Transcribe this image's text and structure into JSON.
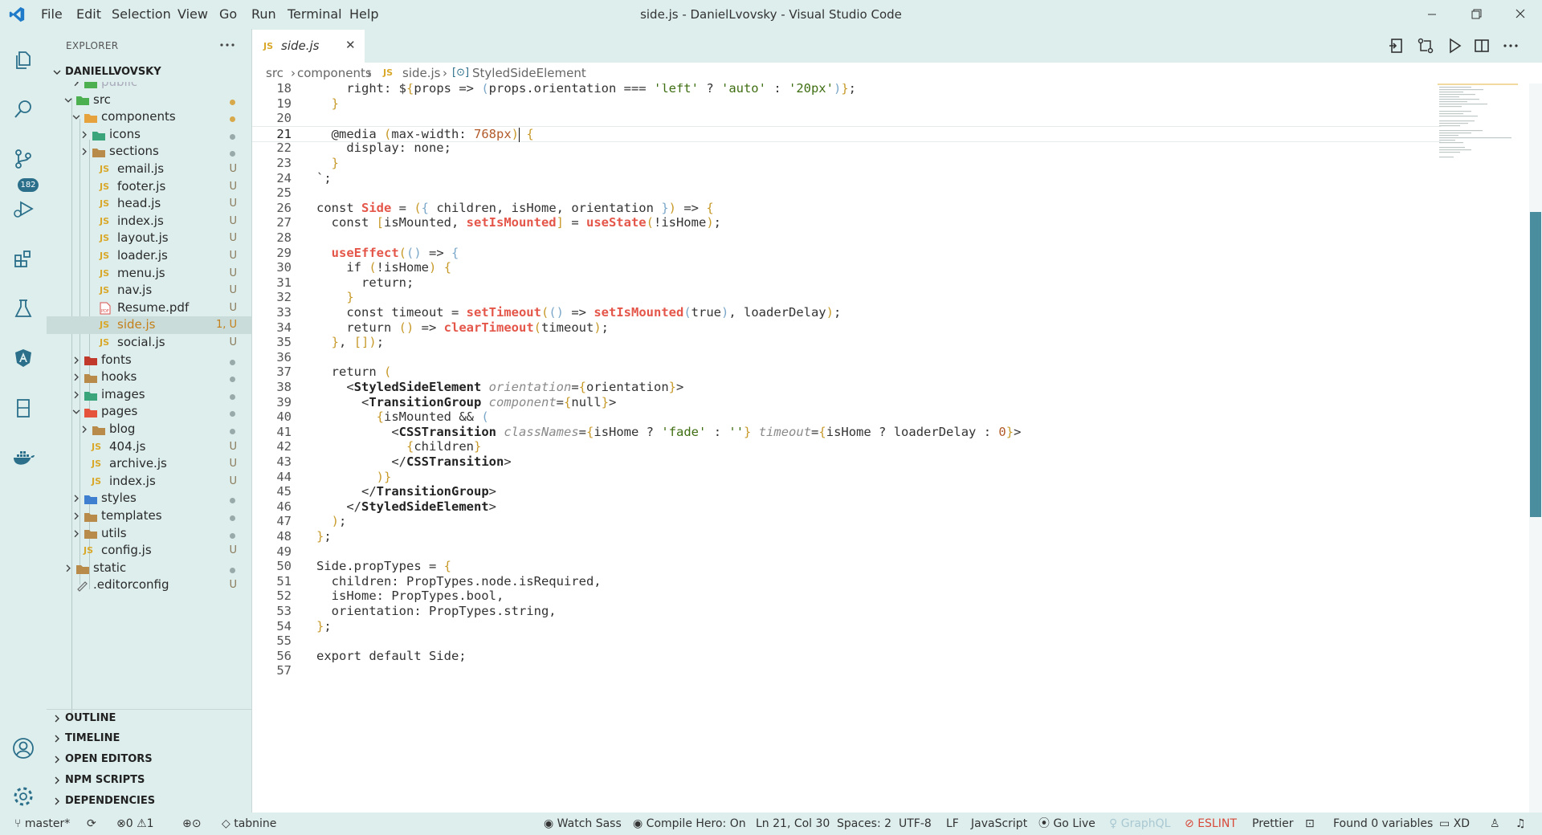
{
  "window": {
    "title": "side.js - DanielLvovsky - Visual Studio Code"
  },
  "menu": [
    "File",
    "Edit",
    "Selection",
    "View",
    "Go",
    "Run",
    "Terminal",
    "Help"
  ],
  "activity": {
    "scm_badge": "182"
  },
  "explorer": {
    "header": "EXPLORER",
    "root": "DANIELLVOVSKY",
    "rows": [
      {
        "label": "public",
        "status": ""
      },
      {
        "label": "src",
        "status": ""
      },
      {
        "label": "components",
        "status": ""
      },
      {
        "label": "icons",
        "status": ""
      },
      {
        "label": "sections",
        "status": ""
      },
      {
        "label": "email.js",
        "status": "U"
      },
      {
        "label": "footer.js",
        "status": "U"
      },
      {
        "label": "head.js",
        "status": "U"
      },
      {
        "label": "index.js",
        "status": "U"
      },
      {
        "label": "layout.js",
        "status": "U"
      },
      {
        "label": "loader.js",
        "status": "U"
      },
      {
        "label": "menu.js",
        "status": "U"
      },
      {
        "label": "nav.js",
        "status": "U"
      },
      {
        "label": "Resume.pdf",
        "status": "U"
      },
      {
        "label": "side.js",
        "status": "1, U"
      },
      {
        "label": "social.js",
        "status": "U"
      },
      {
        "label": "fonts",
        "status": ""
      },
      {
        "label": "hooks",
        "status": ""
      },
      {
        "label": "images",
        "status": ""
      },
      {
        "label": "pages",
        "status": ""
      },
      {
        "label": "blog",
        "status": ""
      },
      {
        "label": "404.js",
        "status": "U"
      },
      {
        "label": "archive.js",
        "status": "U"
      },
      {
        "label": "index.js",
        "status": "U"
      },
      {
        "label": "styles",
        "status": ""
      },
      {
        "label": "templates",
        "status": ""
      },
      {
        "label": "utils",
        "status": ""
      },
      {
        "label": "config.js",
        "status": "U"
      },
      {
        "label": "static",
        "status": ""
      },
      {
        "label": ".editorconfig",
        "status": "U"
      }
    ],
    "sections": [
      "OUTLINE",
      "TIMELINE",
      "OPEN EDITORS",
      "NPM SCRIPTS",
      "DEPENDENCIES"
    ]
  },
  "tab": {
    "name": "side.js",
    "icon": "JS"
  },
  "breadcrumb": [
    "src",
    "components",
    "JS",
    "side.js",
    "StyledSideElement"
  ],
  "editor": {
    "line_numbers": [
      "18",
      "19",
      "20",
      "21",
      "22",
      "23",
      "24",
      "25",
      "26",
      "27",
      "28",
      "29",
      "30",
      "31",
      "32",
      "33",
      "34",
      "35",
      "36",
      "37",
      "38",
      "39",
      "40",
      "41",
      "42",
      "43",
      "44",
      "45",
      "46",
      "47",
      "48",
      "49",
      "50",
      "51",
      "52",
      "53",
      "54",
      "55",
      "56",
      "57"
    ],
    "lines": [
      "    right: ${props => (props.orientation === 'left' ? 'auto' : '20px')};",
      "  }",
      "",
      "  @media (max-width: 768px) {",
      "    display: none;",
      "  }",
      "`;",
      "",
      "const Side = ({ children, isHome, orientation }) => {",
      "  const [isMounted, setIsMounted] = useState(!isHome);",
      "",
      "  useEffect(() => {",
      "    if (!isHome) {",
      "      return;",
      "    }",
      "    const timeout = setTimeout(() => setIsMounted(true), loaderDelay);",
      "    return () => clearTimeout(timeout);",
      "  }, []);",
      "",
      "  return (",
      "    <StyledSideElement orientation={orientation}>",
      "      <TransitionGroup component={null}>",
      "        {isMounted && (",
      "          <CSSTransition classNames={isHome ? 'fade' : ''} timeout={isHome ? loaderDelay : 0}>",
      "            {children}",
      "          </CSSTransition>",
      "        )}",
      "      </TransitionGroup>",
      "    </StyledSideElement>",
      "  );",
      "};",
      "",
      "Side.propTypes = {",
      "  children: PropTypes.node.isRequired,",
      "  isHome: PropTypes.bool,",
      "  orientation: PropTypes.string,",
      "};",
      "",
      "export default Side;",
      ""
    ]
  },
  "status": {
    "branch": "master*",
    "errors": "0",
    "warnings": "1",
    "tabnine": "tabnine",
    "watch_sass": "Watch Sass",
    "compile_hero": "Compile Hero: On",
    "position": "Ln 21, Col 30",
    "spaces": "Spaces: 2",
    "encoding": "UTF-8",
    "eol": "LF",
    "language": "JavaScript",
    "go_live": "Go Live",
    "graphql": "GraphQL",
    "eslint": "ESLINT",
    "prettier": "Prettier",
    "variables": "Found 0 variables",
    "xd": "XD"
  }
}
